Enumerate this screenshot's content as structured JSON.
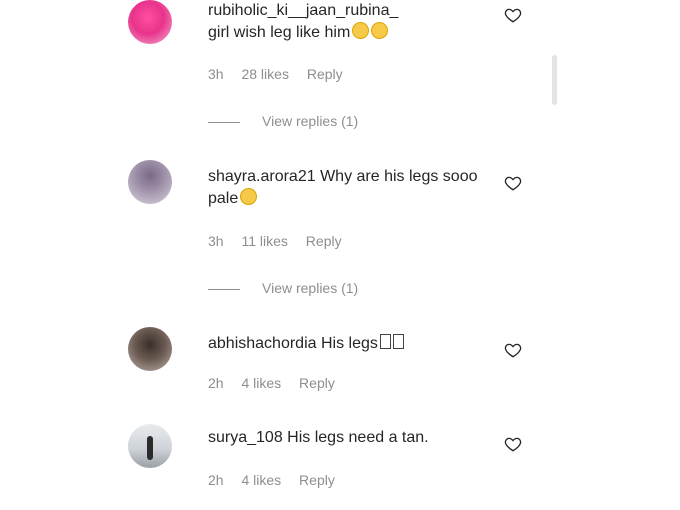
{
  "comments": [
    {
      "username": "rubiholic_ki__jaan_rubina_",
      "text": "girl wish leg like him",
      "time": "3h",
      "likes": "28 likes",
      "reply": "Reply",
      "view_replies": "View replies (1)"
    },
    {
      "username": "shayra.arora21",
      "text": "Why are his legs sooo pale",
      "time": "3h",
      "likes": "11 likes",
      "reply": "Reply",
      "view_replies": "View replies (1)"
    },
    {
      "username": "abhishachordia",
      "text": "His legs",
      "time": "2h",
      "likes": "4 likes",
      "reply": "Reply"
    },
    {
      "username": "surya_108",
      "text": "His legs need a tan.",
      "time": "2h",
      "likes": "4 likes",
      "reply": "Reply"
    }
  ],
  "icons": {
    "like": "heart-outline-icon",
    "emoji_1": "smiling-face-emoji",
    "emoji_2": "laughing-face-emoji"
  },
  "colors": {
    "text": "#262626",
    "secondary": "#8e8e8e"
  }
}
